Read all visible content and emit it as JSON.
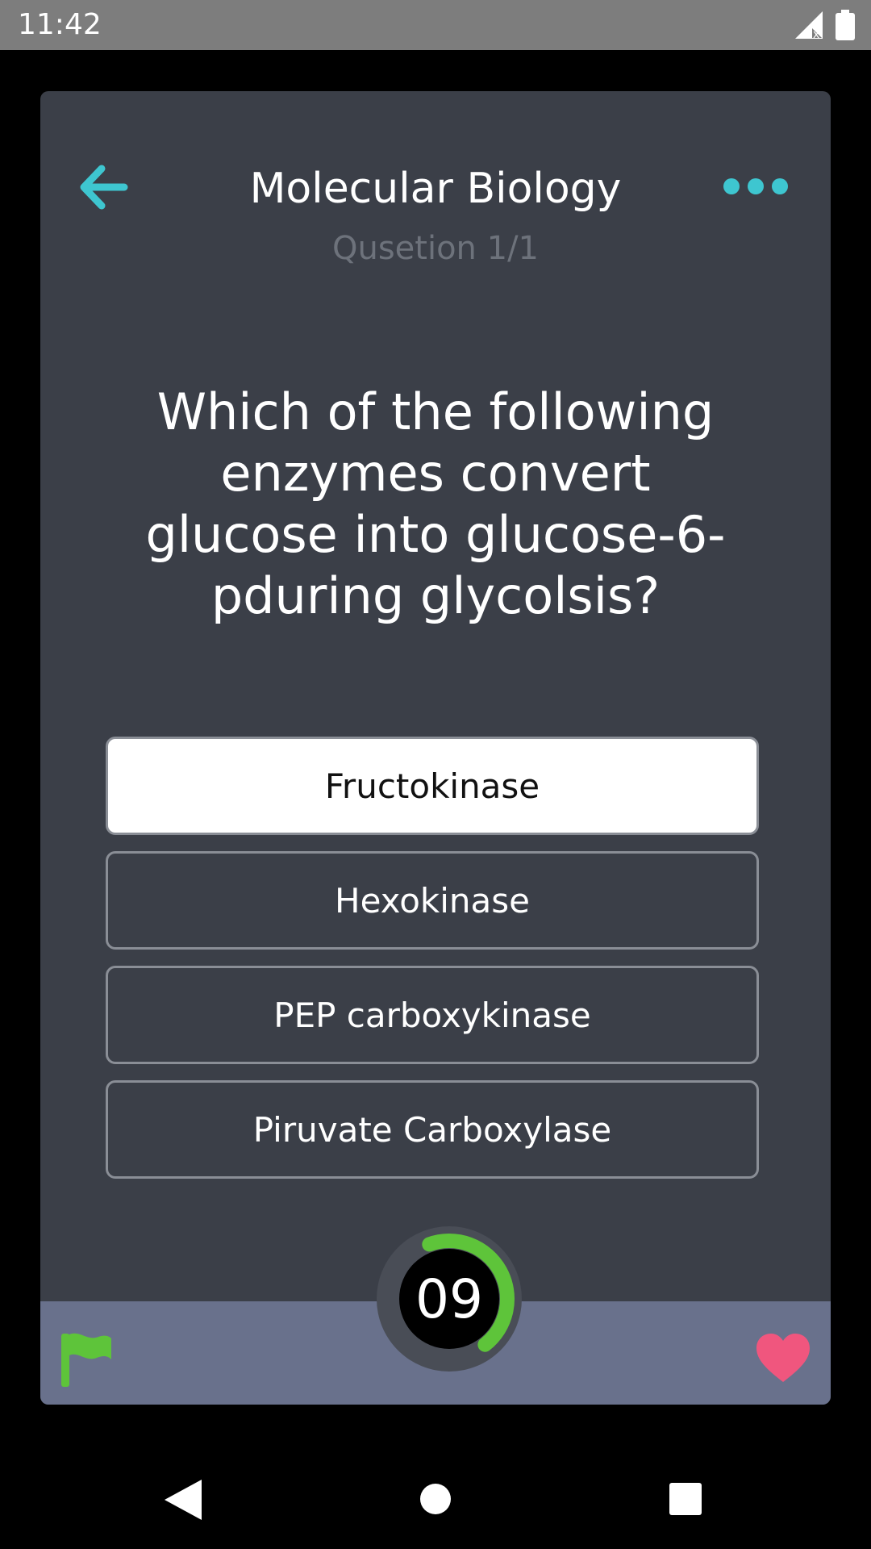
{
  "status_bar": {
    "time": "11:42"
  },
  "header": {
    "title": "Molecular Biology",
    "subtitle": "Qusetion 1/1"
  },
  "question": {
    "text": "Which of the following enzymes convert glucose into glucose-6-pduring glycolsis?"
  },
  "options": [
    {
      "label": "Fructokinase",
      "selected": true
    },
    {
      "label": "Hexokinase",
      "selected": false
    },
    {
      "label": "PEP carboxykinase",
      "selected": false
    },
    {
      "label": "Piruvate Carboxylase",
      "selected": false
    }
  ],
  "timer": {
    "value": "09",
    "progress": 0.45,
    "color": "#5ec43a"
  },
  "colors": {
    "accent": "#3ec6d0",
    "card_bg": "#3b3f48",
    "footer_bg": "#69718c",
    "flag": "#5ec43a",
    "heart": "#f0567e"
  },
  "icons": {
    "back": "arrow-left-icon",
    "more": "more-dots-icon",
    "flag": "flag-icon",
    "heart": "heart-icon"
  }
}
